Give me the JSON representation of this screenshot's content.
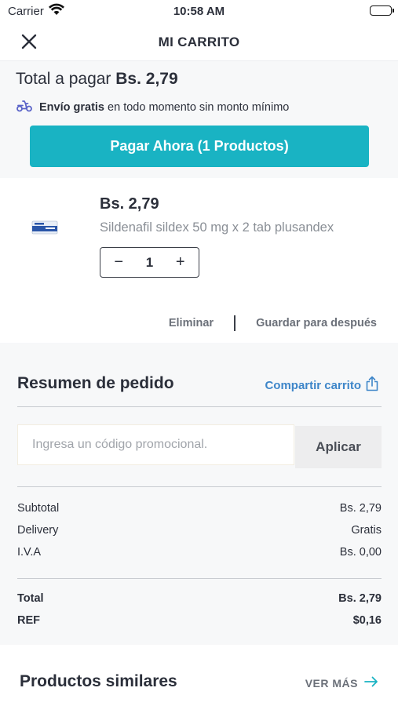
{
  "status_bar": {
    "carrier": "Carrier",
    "time": "10:58 AM"
  },
  "nav": {
    "title": "MI CARRITO",
    "close_icon": "close-icon"
  },
  "checkout": {
    "total_label": "Total a pagar",
    "total_amount": "Bs. 2,79",
    "shipping_bold": "Envío gratis",
    "shipping_text": "en todo momento sin monto mínimo",
    "pay_button": "Pagar Ahora (1 Productos)"
  },
  "product": {
    "price": "Bs. 2,79",
    "name": "Sildenafil sildex 50 mg x 2 tab plusandex",
    "quantity": "1",
    "decrement": "−",
    "increment": "+",
    "remove": "Eliminar",
    "save_later": "Guardar para después"
  },
  "summary": {
    "heading": "Resumen de pedido",
    "share": "Compartir carrito",
    "promo_placeholder": "Ingresa un código promocional.",
    "apply": "Aplicar",
    "lines": [
      {
        "label": "Subtotal",
        "value": "Bs. 2,79"
      },
      {
        "label": "Delivery",
        "value": "Gratis"
      },
      {
        "label": "I.V.A",
        "value": "Bs. 0,00"
      }
    ],
    "totals": [
      {
        "label": "Total",
        "value": "Bs. 2,79"
      },
      {
        "label": "REF",
        "value": "$0,16"
      }
    ]
  },
  "similar": {
    "title": "Productos similares",
    "more": "VER MÁS"
  },
  "colors": {
    "accent": "#19b3c3",
    "link": "#3e86c9",
    "text": "#2b2f3a",
    "muted": "#8a8f96"
  }
}
